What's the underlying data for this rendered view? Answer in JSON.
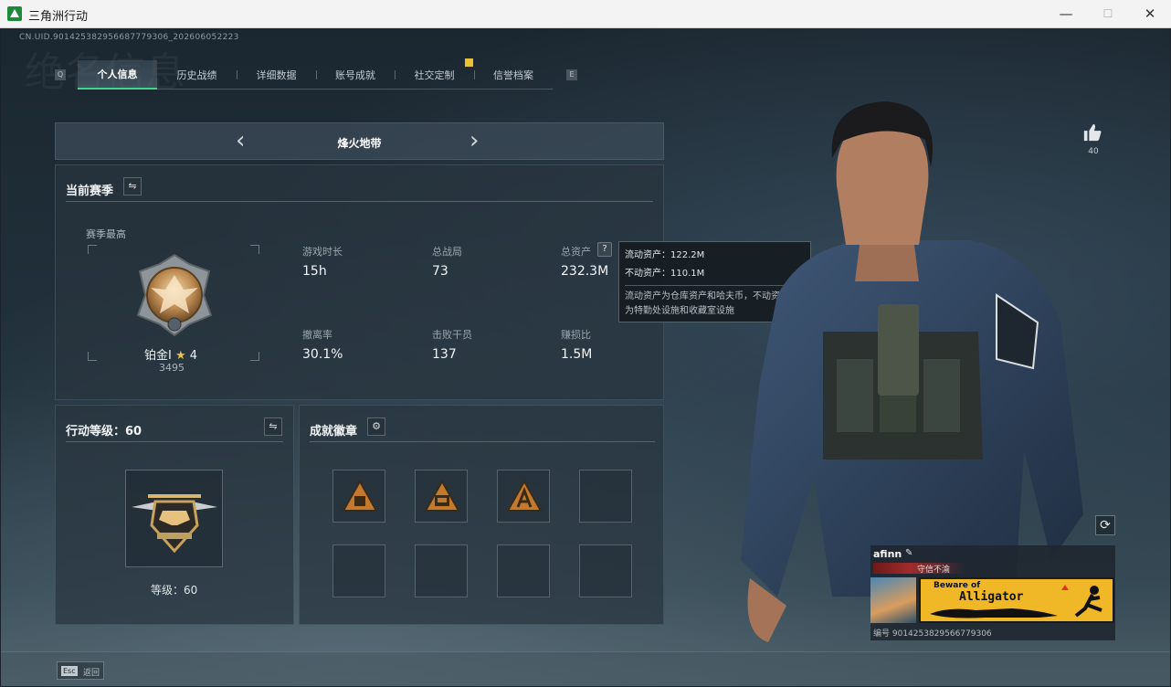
{
  "window": {
    "title": "三角洲行动",
    "minimize": "—",
    "maximize": "☐",
    "close": "✕"
  },
  "uid_top": "CN.UID.9014253829566877793​06_20260605222​3",
  "bg_watermark": "绝名信息",
  "tabs": {
    "left_arrow": "Q",
    "right_arrow": "E",
    "items": [
      {
        "label": "个人信息",
        "active": true
      },
      {
        "label": "历史战绩",
        "active": false
      },
      {
        "label": "详细数据",
        "active": false
      },
      {
        "label": "账号成就",
        "active": false
      },
      {
        "label": "社交定制",
        "active": false
      },
      {
        "label": "信誉档案",
        "active": false
      }
    ]
  },
  "mode_selector": {
    "label": "烽火地带",
    "prev": "‹",
    "next": "›"
  },
  "season": {
    "title": "当前赛季",
    "swap_icon": "⇋",
    "best_label": "赛季最高",
    "rank_name": "铂金I",
    "rank_star": "★",
    "rank_stars": "4",
    "rank_score": "3495",
    "stats": [
      {
        "label": "游戏时长",
        "value": "15h"
      },
      {
        "label": "总战局",
        "value": "73"
      },
      {
        "label": "总资产",
        "value": "232.3M"
      },
      {
        "label": "撤离率",
        "value": "30.1%"
      },
      {
        "label": "击败干员",
        "value": "137"
      },
      {
        "label": "赚损比",
        "value": "1.5M"
      }
    ],
    "help_icon": "?"
  },
  "tooltip": {
    "liquid": "流动资产：122.2M",
    "fixed": "不动资产：110.1M",
    "desc_line1": "流动资产为仓库资产和哈夫币，不动资产",
    "desc_line2": "为特勤处设施和收藏室设施"
  },
  "level": {
    "title": "行动等级：60",
    "swap_icon": "⇋",
    "level_label": "等级：60"
  },
  "badges": {
    "title": "成就徽章",
    "gear_icon": "⚙",
    "slots": [
      {
        "filled": true
      },
      {
        "filled": true
      },
      {
        "filled": true
      },
      {
        "filled": false
      },
      {
        "filled": false
      },
      {
        "filled": false
      },
      {
        "filled": false
      },
      {
        "filled": false
      }
    ]
  },
  "profile": {
    "like_count": "40",
    "refresh_icon": "⟳",
    "name": "afinn",
    "edit_icon": "✎",
    "title_tag": "守信不渝",
    "banner_line1": "Beware of",
    "banner_line2": "Alligator",
    "uid": "编号 9014253829566779306"
  },
  "footer": {
    "esc_key": "Esc",
    "esc_label": "返回"
  },
  "colors": {
    "accent": "#3fd88a",
    "notif": "#e8c233",
    "banner": "#f0b726"
  }
}
